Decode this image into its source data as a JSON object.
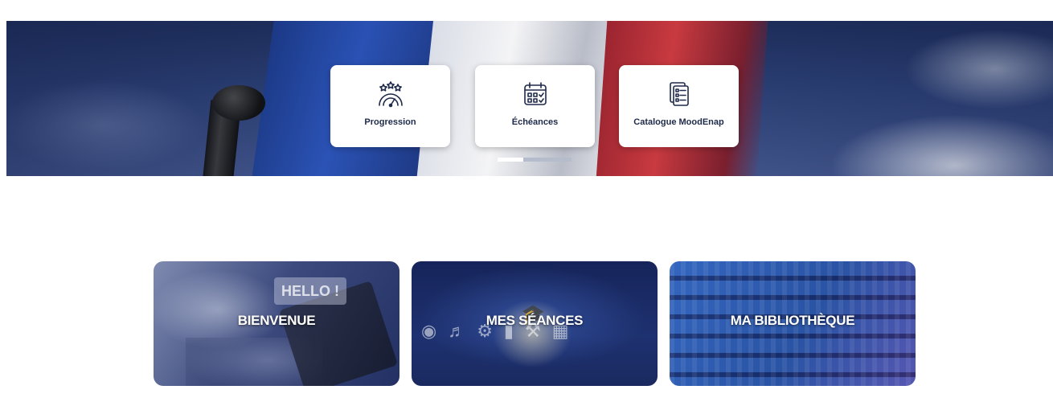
{
  "hero": {
    "quick_links": [
      {
        "label": "Progression",
        "icon": "gauge-stars-icon"
      },
      {
        "label": "Échéances",
        "icon": "calendar-icon"
      },
      {
        "label": "Catalogue MoodEnap",
        "icon": "checklist-documents-icon"
      }
    ],
    "slider": {
      "active_index": 0,
      "count": 2
    }
  },
  "tiles": [
    {
      "label": "BIENVENUE",
      "decor_text": "HELLO !"
    },
    {
      "label": "MES SÉANCES"
    },
    {
      "label": "MA BIBLIOTHÈQUE"
    }
  ],
  "colors": {
    "card_text": "#1e2a4a",
    "hero_navy": "#1d2d5a",
    "flag_blue": "#2a53b8",
    "flag_red": "#c83a3f",
    "dot_active": "#ffffff",
    "dot_inactive": "#b5bccb"
  }
}
